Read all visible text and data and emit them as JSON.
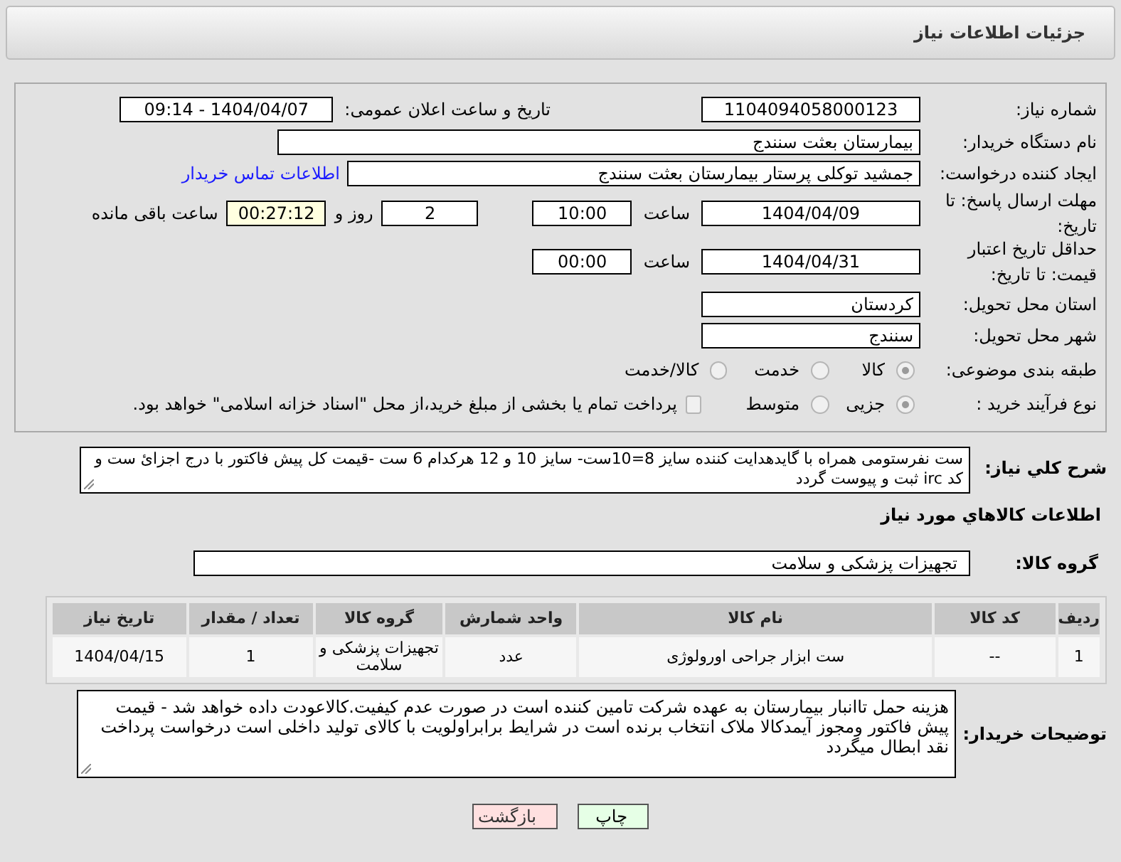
{
  "header": {
    "title": "جزئیات اطلاعات نیاز"
  },
  "need_number": {
    "label": "شماره نیاز:",
    "value": "1104094058000123"
  },
  "announce": {
    "label": "تاریخ و ساعت اعلان عمومی:",
    "value": "1404/04/07 - 09:14"
  },
  "buyer_org": {
    "label": "نام دستگاه خریدار:",
    "value": "بیمارستان بعثت سنندج"
  },
  "requester": {
    "label": "ایجاد کننده درخواست:",
    "value": "جمشید  توکلی پرستار بیمارستان بعثت سنندج",
    "link": "اطلاعات تماس خریدار"
  },
  "deadline": {
    "label": "مهلت ارسال پاسخ: تا تاریخ:",
    "date": "1404/04/09",
    "time_label": "ساعت",
    "time": "10:00",
    "days": "2",
    "days_label": "روز و",
    "remaining": "00:27:12",
    "remaining_label": "ساعت باقی مانده"
  },
  "validity": {
    "label": "حداقل تاریخ اعتبار قیمت: تا تاریخ:",
    "date": "1404/04/31",
    "time_label": "ساعت",
    "time": "00:00"
  },
  "province": {
    "label": "استان محل تحویل:",
    "value": "کردستان"
  },
  "city": {
    "label": "شهر محل تحویل:",
    "value": "سنندج"
  },
  "category": {
    "label": "طبقه بندی موضوعی:",
    "options": [
      {
        "label": "کالا",
        "selected": true
      },
      {
        "label": "خدمت",
        "selected": false
      },
      {
        "label": "کالا/خدمت",
        "selected": false
      }
    ]
  },
  "purchase_type": {
    "label": "نوع فرآیند خرید :",
    "options": [
      {
        "label": "جزیی",
        "selected": true
      },
      {
        "label": "متوسط",
        "selected": false
      }
    ],
    "payment_note": {
      "label": "پرداخت تمام یا بخشی از مبلغ خرید،از محل \"اسناد خزانه اسلامی\" خواهد بود.",
      "checked": false
    }
  },
  "description": {
    "label": "شرح کلي نياز:",
    "value": "ست نفرستومی همراه با گایدهدایت کننده سایز 8=10ست- سایز 10 و 12 هرکدام 6 ست -قیمت کل پیش فاکتور با درج اجزائ ست و کد irc ثبت و پیوست گردد"
  },
  "goods_section": {
    "title": "اطلاعات کالاهاي مورد نياز"
  },
  "goods_group": {
    "label": "گروه کالا:",
    "value": "تجهیزات پزشکی و سلامت"
  },
  "table": {
    "columns": [
      "ردیف",
      "کد کالا",
      "نام کالا",
      "واحد شمارش",
      "گروه کالا",
      "تعداد / مقدار",
      "تاریخ نیاز"
    ],
    "rows": [
      [
        "1",
        "--",
        "ست ابزار جراحی اورولوژی",
        "عدد",
        "تجهیزات پزشکی و سلامت",
        "1",
        "1404/04/15"
      ]
    ]
  },
  "buyer_notes": {
    "label": "توضیحات خریدار:",
    "value": "هزینه حمل تاانبار بیمارستان به عهده شرکت تامین کننده است در صورت عدم کیفیت.کالاعودت داده خواهد شد - قیمت پیش فاکتور ومجوز آیمدکالا ملاک انتخاب برنده است در شرایط برابراولویت با کالای تولید داخلی است درخواست پرداخت نقد ابطال میگردد"
  },
  "buttons": [
    {
      "label": "چاپ",
      "kind": "print"
    },
    {
      "label": "بازگشت",
      "kind": "back"
    }
  ]
}
